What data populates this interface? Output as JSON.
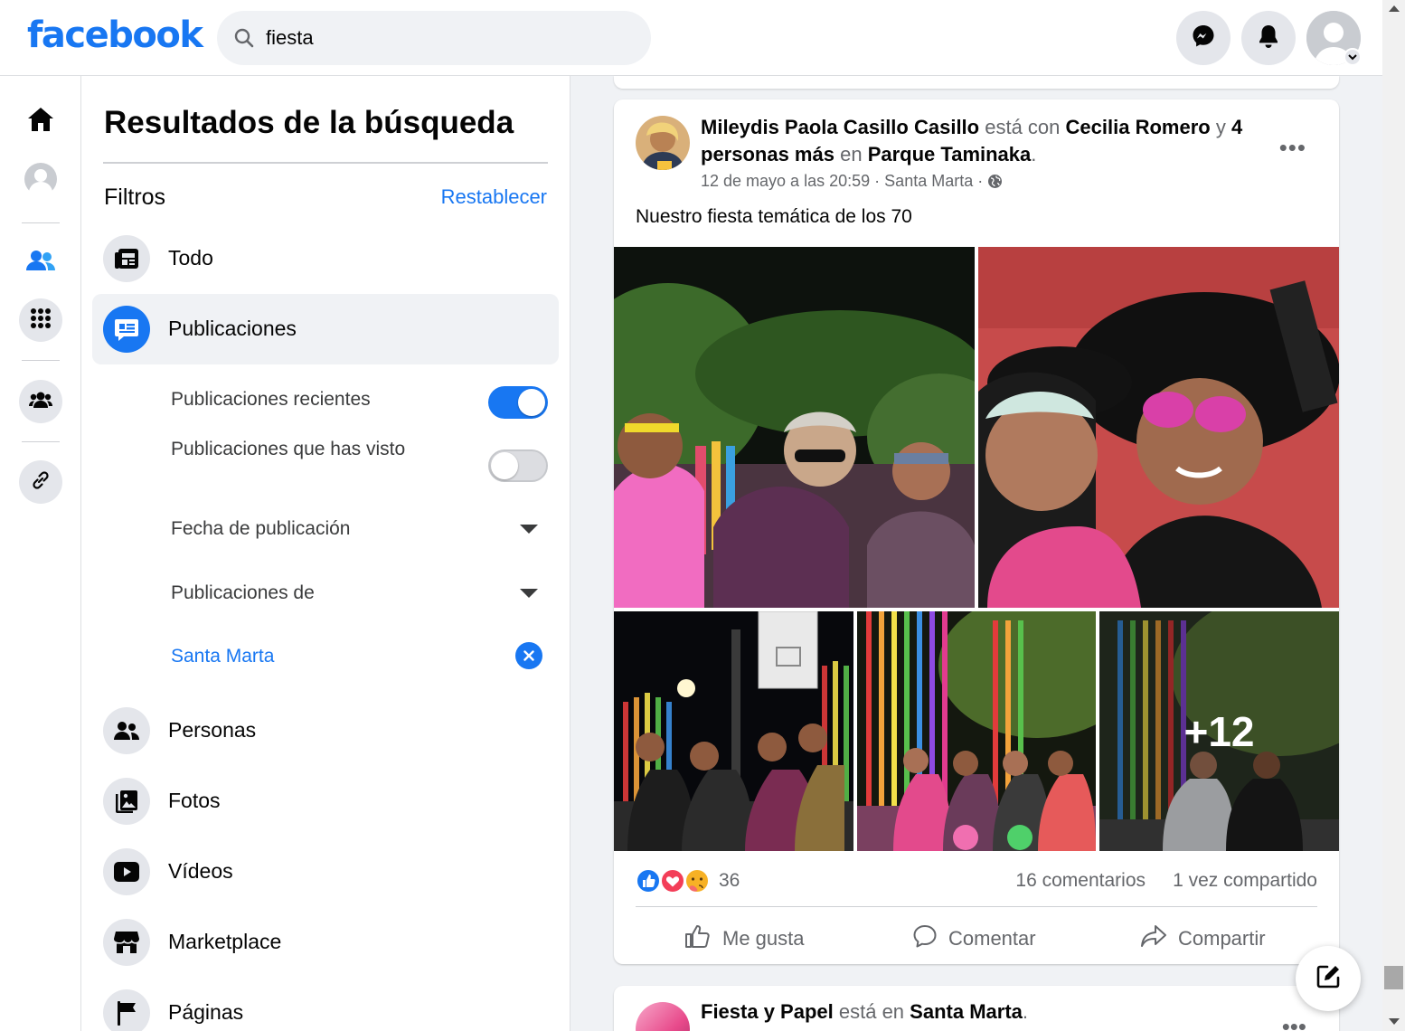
{
  "header": {
    "logo": "facebook",
    "search_value": "fiesta",
    "icons": [
      "search-icon",
      "messenger-icon",
      "bell-icon",
      "user-avatar"
    ]
  },
  "rail": {
    "icons": [
      "home-icon",
      "profile-icon",
      "friends-icon",
      "apps-grid-icon",
      "groups-icon",
      "link-icon"
    ]
  },
  "panel": {
    "title": "Resultados de la búsqueda",
    "filters_label": "Filtros",
    "reset_label": "Restablecer",
    "nav": [
      {
        "label": "Todo",
        "icon": "feed-icon"
      },
      {
        "label": "Publicaciones",
        "icon": "posts-icon",
        "active": true
      },
      {
        "label": "Personas",
        "icon": "people-icon"
      },
      {
        "label": "Fotos",
        "icon": "photos-icon"
      },
      {
        "label": "Vídeos",
        "icon": "video-icon"
      },
      {
        "label": "Marketplace",
        "icon": "marketplace-icon"
      },
      {
        "label": "Páginas",
        "icon": "flag-icon"
      }
    ],
    "sub": {
      "recent": {
        "label": "Publicaciones recientes",
        "on": true
      },
      "seen": {
        "label": "Publicaciones que has visto",
        "on": false
      },
      "date": "Fecha de publicación",
      "from": "Publicaciones de",
      "location": "Santa Marta"
    }
  },
  "post": {
    "author": "Mileydis Paola Casillo Casillo",
    "with_word": "está con",
    "tagged": "Cecilia Romero",
    "and_word": "y",
    "others": "4 personas más",
    "in_word": "en",
    "place": "Parque Taminaka",
    "period": ".",
    "timestamp": "12 de mayo a las 20:59",
    "location": "Santa Marta",
    "separator": "·",
    "text": "Nuestro fiesta temática de los 70",
    "more_photos": "+12",
    "reactions_count": "36",
    "comments": "16 comentarios",
    "shares": "1 vez compartido",
    "actions": {
      "like": "Me gusta",
      "comment": "Comentar",
      "share": "Compartir"
    }
  },
  "post2": {
    "author": "Fiesta y Papel",
    "in_word": "está en",
    "place": "Santa Marta",
    "period": "."
  },
  "colors": {
    "brand": "#1877f2",
    "secondary_text": "#65676b",
    "panel_bg": "#f0f2f5"
  }
}
